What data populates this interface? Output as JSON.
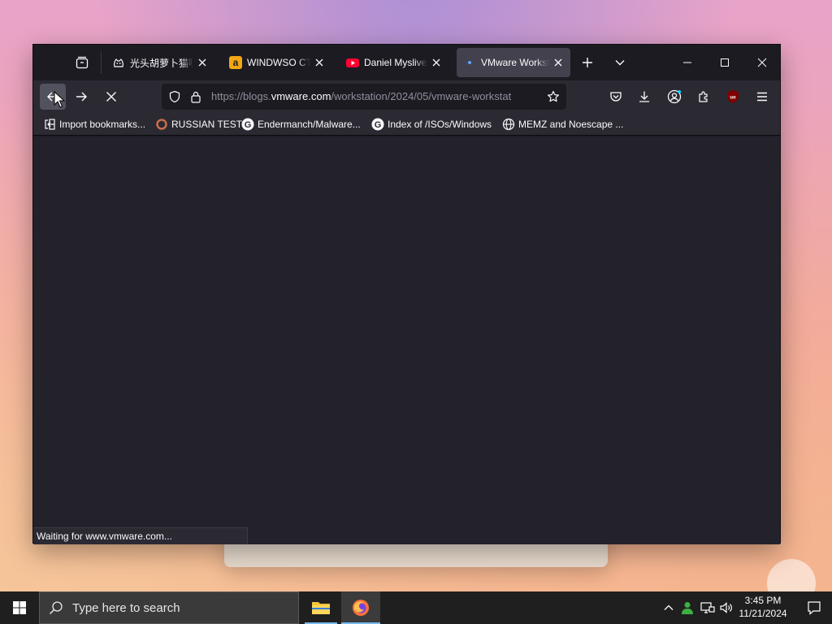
{
  "browser": {
    "tabs": [
      {
        "title": "光头胡萝卜猫咪",
        "icon": "cat-face-icon"
      },
      {
        "title": "WINDWSO CTA",
        "icon": "amazon-a-icon",
        "color": "#f3a712"
      },
      {
        "title": "Daniel Myslivets",
        "icon": "youtube-icon",
        "color": "#ff0033"
      },
      {
        "title": "VMware Workst",
        "icon": "loading-dot-icon",
        "active": true
      }
    ],
    "url": {
      "prefix": "https://blogs.",
      "host": "vmware.com",
      "path": "/workstation/2024/05/vmware-workstat"
    },
    "bookmarks": [
      {
        "label": "Import bookmarks...",
        "icon": "import-icon"
      },
      {
        "label": "RUSSIAN TEST",
        "icon": "ring-icon"
      },
      {
        "label": "Endermanch/Malware...",
        "icon": "google-g-icon"
      },
      {
        "label": "Index of /ISOs/Windows",
        "icon": "google-g-icon"
      },
      {
        "label": "MEMZ and Noescape ...",
        "icon": "globe-icon"
      }
    ],
    "status_text": "Waiting for www.vmware.com..."
  },
  "taskbar": {
    "search_placeholder": "Type here to search",
    "time": "3:45 PM",
    "date": "11/21/2024"
  },
  "colors": {
    "accent": "#76b9ed",
    "chrome": "#2b2a33",
    "tabbar": "#1c1b22",
    "content": "#23222b"
  }
}
